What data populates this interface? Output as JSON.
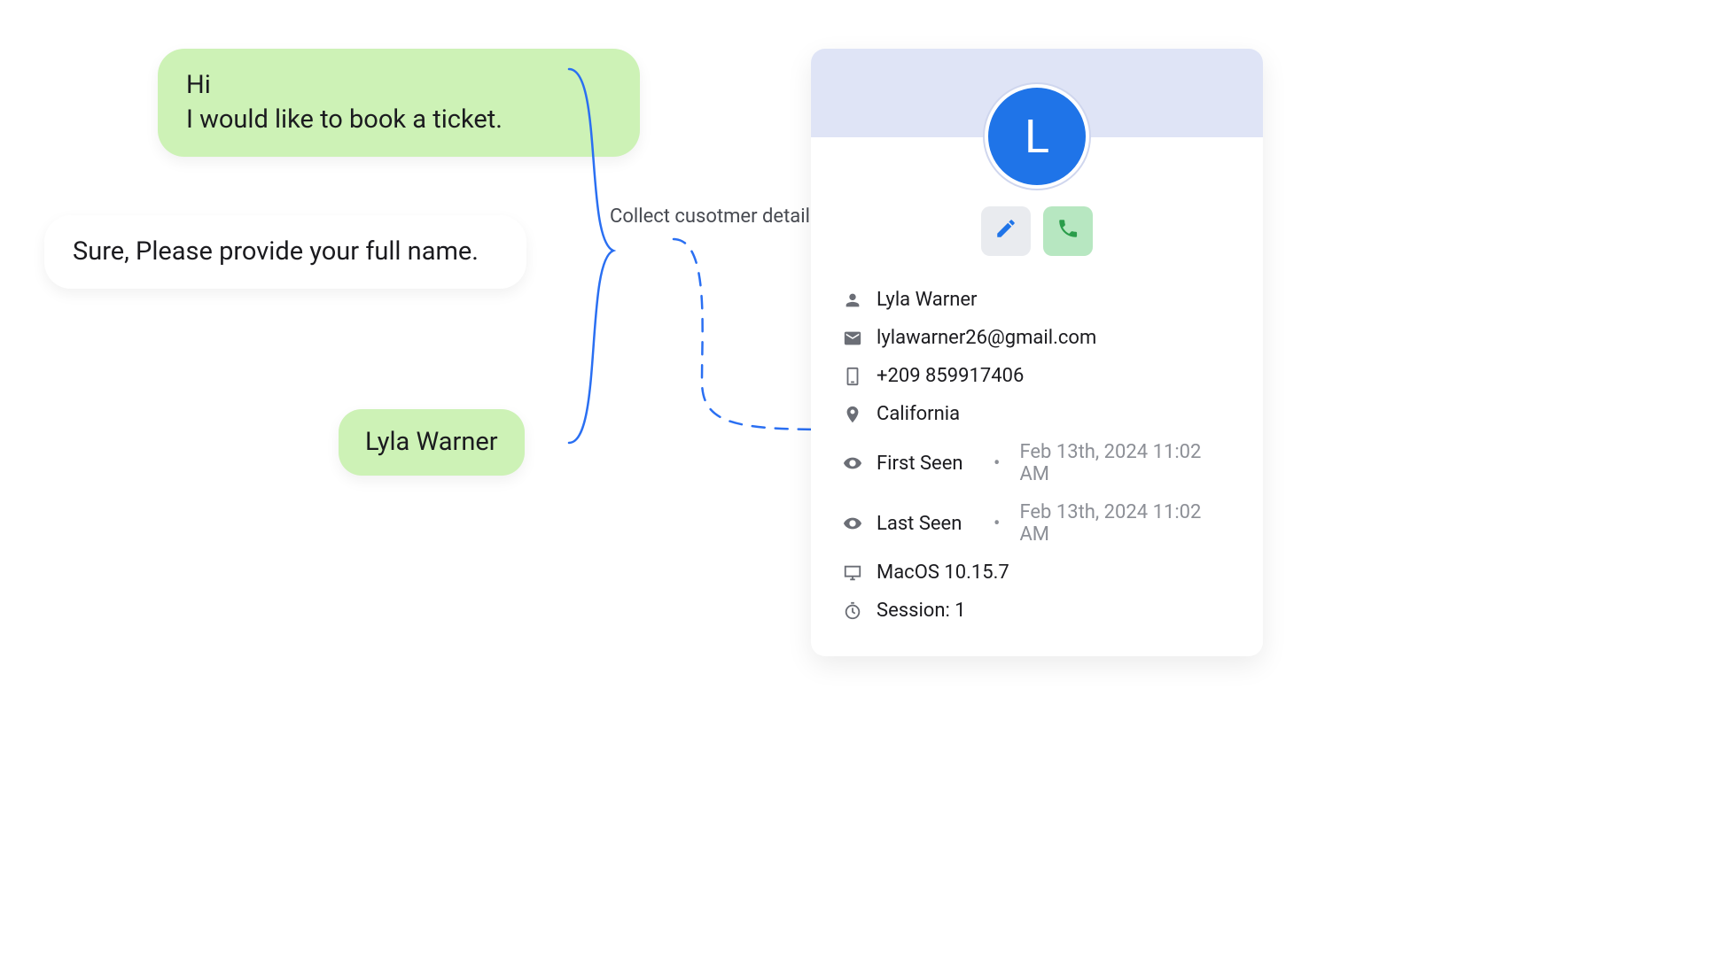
{
  "chat": {
    "msg1_line1": "Hi",
    "msg1_line2": "I would like to book a ticket.",
    "msg2": "Sure, Please provide your full name.",
    "msg3": "Lyla Warner"
  },
  "annotation": "Collect cusotmer details",
  "customer": {
    "avatar_initial": "L",
    "name": "Lyla Warner",
    "email": "lylawarner26@gmail.com",
    "phone": "+209 859917406",
    "location": "California",
    "first_seen_label": "First Seen",
    "first_seen_value": "Feb 13th, 2024 11:02 AM",
    "last_seen_label": "Last Seen",
    "last_seen_value": "Feb 13th, 2024 11:02 AM",
    "device": "MacOS 10.15.7",
    "session": "Session: 1"
  }
}
